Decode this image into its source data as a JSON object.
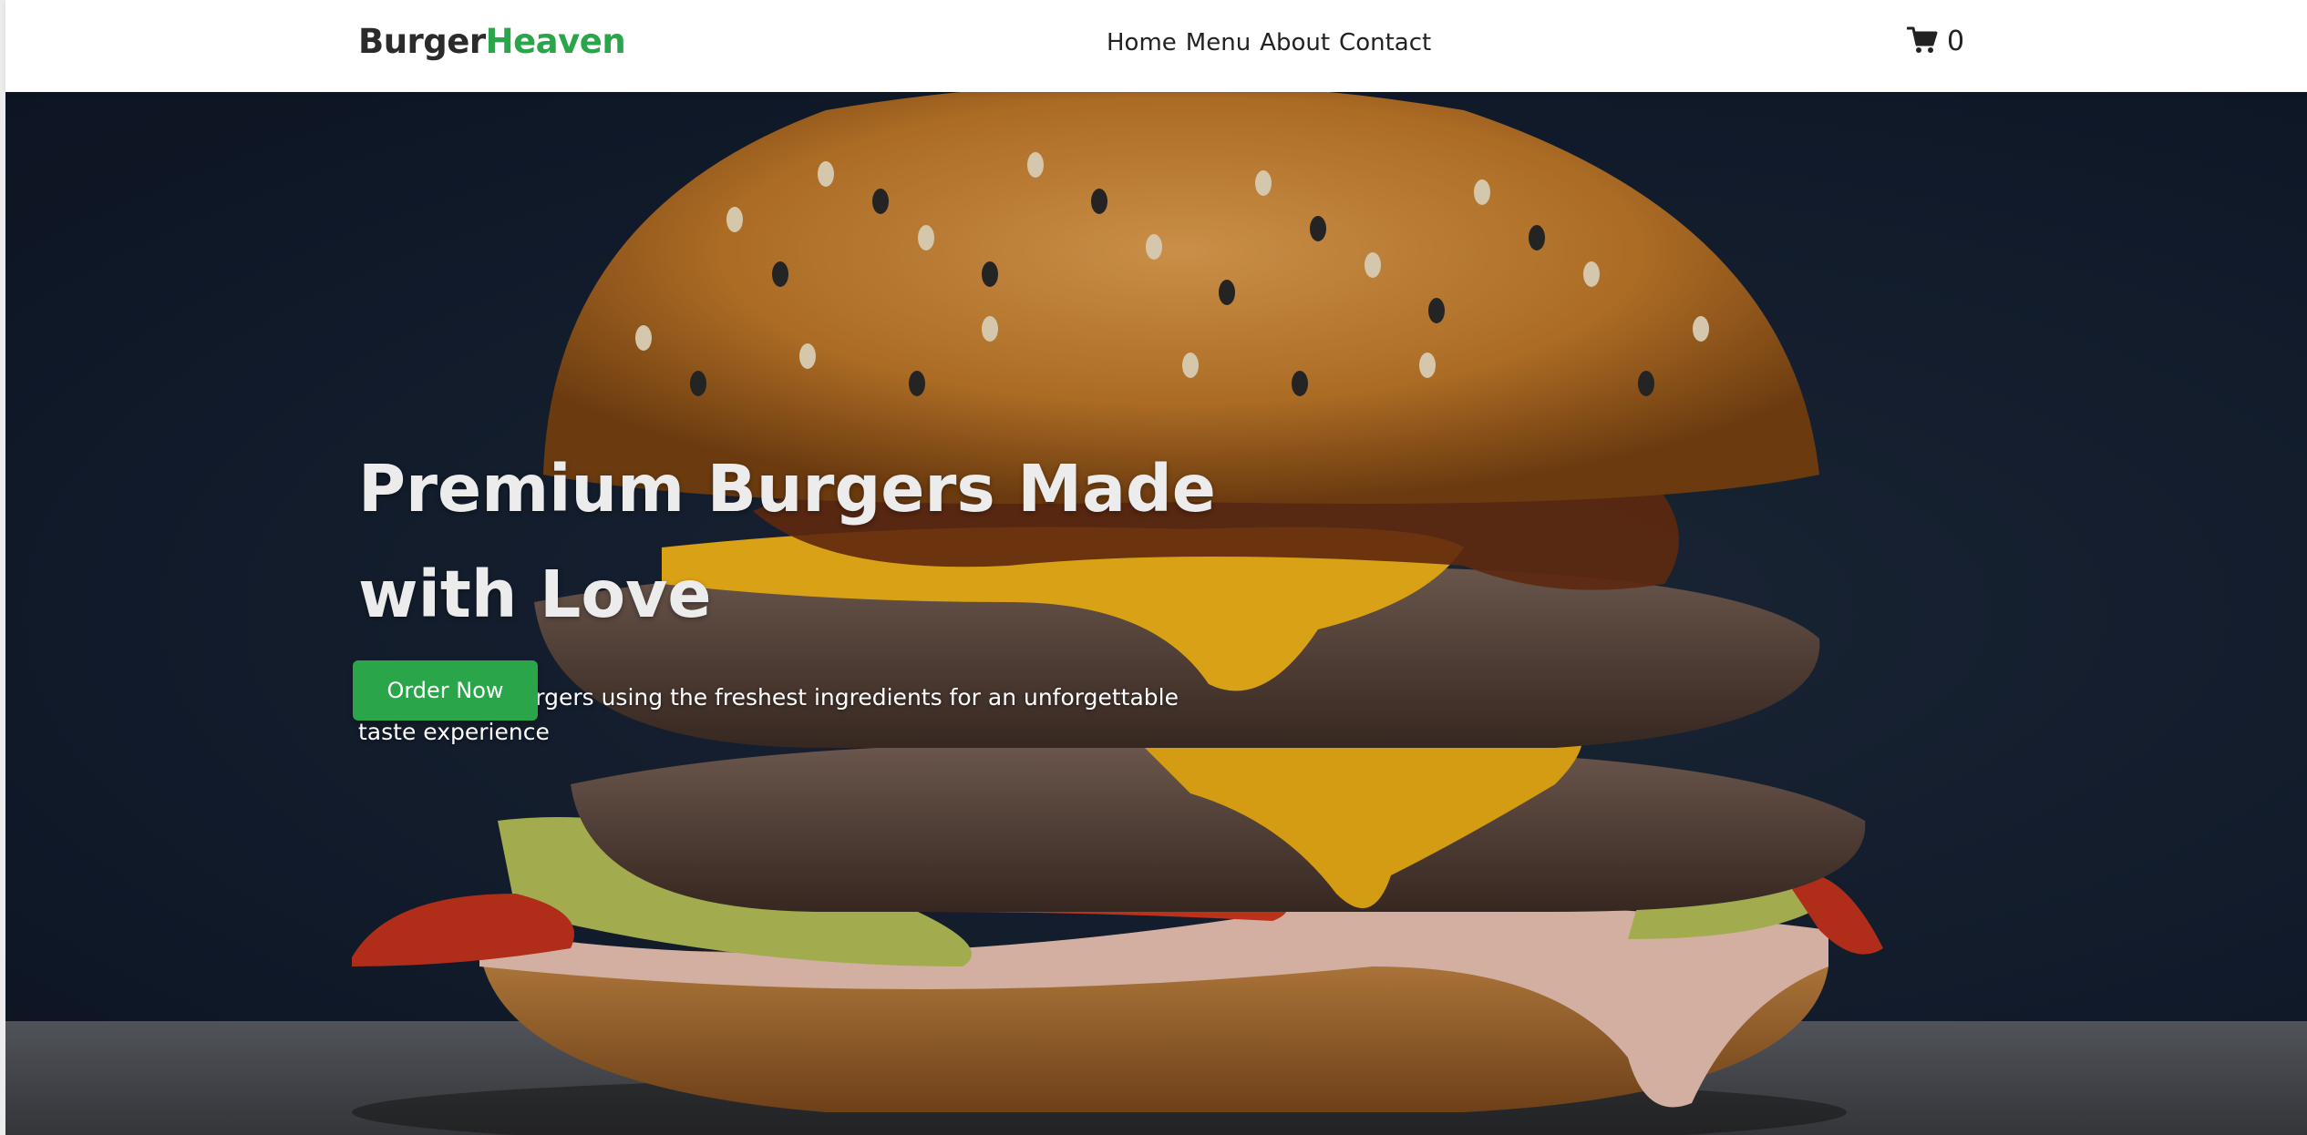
{
  "brand": {
    "part1": "Burger",
    "part2": "Heaven",
    "colors": {
      "dark": "#2b2b2b",
      "accent": "#2aa54a"
    }
  },
  "nav": {
    "items": [
      {
        "label": "Home"
      },
      {
        "label": "Menu"
      },
      {
        "label": "About"
      },
      {
        "label": "Contact"
      }
    ]
  },
  "cart": {
    "icon": "shopping-cart-icon",
    "count": "0"
  },
  "hero": {
    "title": "Premium Burgers Made with Love",
    "subtitle": "Handcrafted burgers using the freshest ingredients for an unforgettable taste experience",
    "cta_label": "Order Now",
    "background_image": "burger-photo"
  }
}
